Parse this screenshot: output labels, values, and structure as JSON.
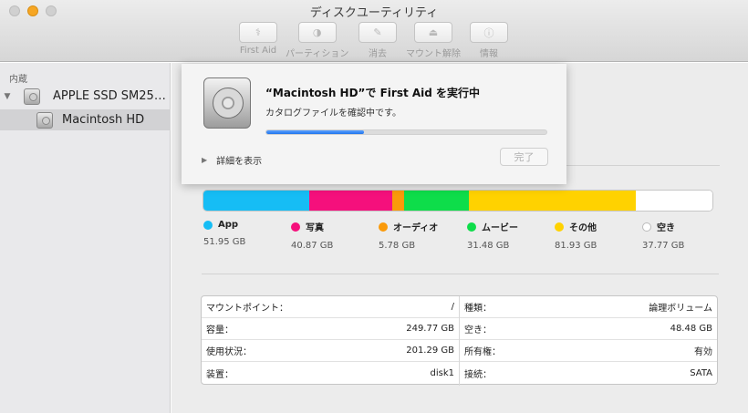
{
  "window": {
    "title": "ディスクユーティリティ"
  },
  "toolbar": {
    "buttons": [
      {
        "label": "First Aid",
        "icon": "stethoscope-icon",
        "glyph": "⚕"
      },
      {
        "label": "パーティション",
        "icon": "partition-pie-icon",
        "glyph": "◑"
      },
      {
        "label": "消去",
        "icon": "erase-icon",
        "glyph": "✎"
      },
      {
        "label": "マウント解除",
        "icon": "eject-icon",
        "glyph": "⏏"
      },
      {
        "label": "情報",
        "icon": "info-icon",
        "glyph": "ⓘ"
      }
    ]
  },
  "sidebar": {
    "section_header": "内蔵",
    "items": [
      {
        "label": "APPLE SSD SM25…",
        "disclosure": "▼"
      },
      {
        "label": "Macintosh HD"
      }
    ]
  },
  "first_aid_sheet": {
    "title": "“Macintosh HD”で First Aid を実行中",
    "status": "カタログファイルを確認中です。",
    "progress": 0.35,
    "details_label": "詳細を表示",
    "done_label": "完了"
  },
  "usage": {
    "categories": [
      {
        "name": "App",
        "size": "51.95 GB",
        "color": "#16bdf5",
        "gb": 51.95
      },
      {
        "name": "写真",
        "size": "40.87 GB",
        "color": "#f5107c",
        "gb": 40.87
      },
      {
        "name": "オーディオ",
        "size": "5.78 GB",
        "color": "#fa9a0a",
        "gb": 5.78
      },
      {
        "name": "ムービー",
        "size": "31.48 GB",
        "color": "#0edd4a",
        "gb": 31.48
      },
      {
        "name": "その他",
        "size": "81.93 GB",
        "color": "#ffd200",
        "gb": 81.93
      },
      {
        "name": "空き",
        "size": "37.77 GB",
        "color": "#ffffff",
        "gb": 37.77
      }
    ]
  },
  "info": {
    "left": [
      {
        "label": "マウントポイント：",
        "value": "/"
      },
      {
        "label": "容量：",
        "value": "249.77 GB"
      },
      {
        "label": "使用状況：",
        "value": "201.29 GB"
      },
      {
        "label": "装置：",
        "value": "disk1"
      }
    ],
    "right": [
      {
        "label": "種類：",
        "value": "論理ボリューム"
      },
      {
        "label": "空き：",
        "value": "48.48 GB"
      },
      {
        "label": "所有権：",
        "value": "有効"
      },
      {
        "label": "接続：",
        "value": "SATA"
      }
    ]
  }
}
